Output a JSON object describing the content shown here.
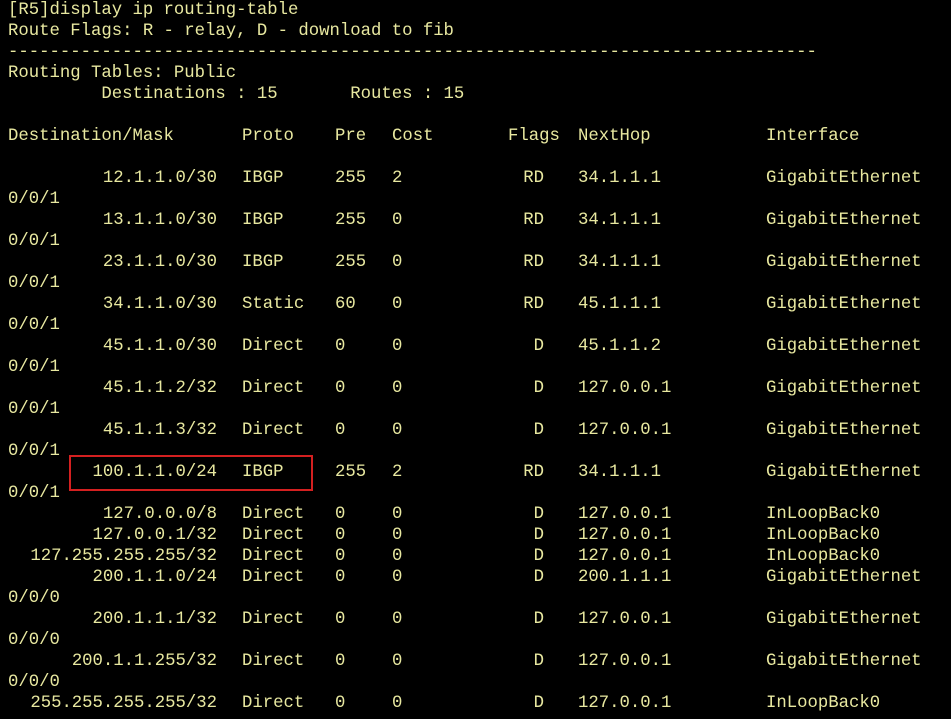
{
  "header": {
    "command": "[R5]display ip routing-table",
    "flags": "Route Flags: R - relay, D - download to fib",
    "separator": "------------------------------------------------------------------------------",
    "tables": "Routing Tables: Public",
    "counts": "         Destinations : 15       Routes : 15"
  },
  "columns": [
    "Destination/Mask",
    "Proto",
    "Pre",
    "Cost",
    "Flags",
    "NextHop",
    "Interface"
  ],
  "routes": [
    {
      "dest": "12.1.1.0/30",
      "proto": "IBGP",
      "pre": "255",
      "cost": "2",
      "flags": "RD",
      "nexthop": "34.1.1.1",
      "iface": "GigabitEthernet",
      "iface2": "0/0/1"
    },
    {
      "dest": "13.1.1.0/30",
      "proto": "IBGP",
      "pre": "255",
      "cost": "0",
      "flags": "RD",
      "nexthop": "34.1.1.1",
      "iface": "GigabitEthernet",
      "iface2": "0/0/1"
    },
    {
      "dest": "23.1.1.0/30",
      "proto": "IBGP",
      "pre": "255",
      "cost": "0",
      "flags": "RD",
      "nexthop": "34.1.1.1",
      "iface": "GigabitEthernet",
      "iface2": "0/0/1"
    },
    {
      "dest": "34.1.1.0/30",
      "proto": "Static",
      "pre": "60",
      "cost": "0",
      "flags": "RD",
      "nexthop": "45.1.1.1",
      "iface": "GigabitEthernet",
      "iface2": "0/0/1"
    },
    {
      "dest": "45.1.1.0/30",
      "proto": "Direct",
      "pre": "0",
      "cost": "0",
      "flags": "D",
      "nexthop": "45.1.1.2",
      "iface": "GigabitEthernet",
      "iface2": "0/0/1"
    },
    {
      "dest": "45.1.1.2/32",
      "proto": "Direct",
      "pre": "0",
      "cost": "0",
      "flags": "D",
      "nexthop": "127.0.0.1",
      "iface": "GigabitEthernet",
      "iface2": "0/0/1"
    },
    {
      "dest": "45.1.1.3/32",
      "proto": "Direct",
      "pre": "0",
      "cost": "0",
      "flags": "D",
      "nexthop": "127.0.0.1",
      "iface": "GigabitEthernet",
      "iface2": "0/0/1"
    },
    {
      "dest": "100.1.1.0/24",
      "proto": "IBGP",
      "pre": "255",
      "cost": "2",
      "flags": "RD",
      "nexthop": "34.1.1.1",
      "iface": "GigabitEthernet",
      "iface2": "0/0/1"
    },
    {
      "dest": "127.0.0.0/8",
      "proto": "Direct",
      "pre": "0",
      "cost": "0",
      "flags": "D",
      "nexthop": "127.0.0.1",
      "iface": "InLoopBack0",
      "iface2": ""
    },
    {
      "dest": "127.0.0.1/32",
      "proto": "Direct",
      "pre": "0",
      "cost": "0",
      "flags": "D",
      "nexthop": "127.0.0.1",
      "iface": "InLoopBack0",
      "iface2": ""
    },
    {
      "dest": "127.255.255.255/32",
      "proto": "Direct",
      "pre": "0",
      "cost": "0",
      "flags": "D",
      "nexthop": "127.0.0.1",
      "iface": "InLoopBack0",
      "iface2": ""
    },
    {
      "dest": "200.1.1.0/24",
      "proto": "Direct",
      "pre": "0",
      "cost": "0",
      "flags": "D",
      "nexthop": "200.1.1.1",
      "iface": "GigabitEthernet",
      "iface2": "0/0/0"
    },
    {
      "dest": "200.1.1.1/32",
      "proto": "Direct",
      "pre": "0",
      "cost": "0",
      "flags": "D",
      "nexthop": "127.0.0.1",
      "iface": "GigabitEthernet",
      "iface2": "0/0/0"
    },
    {
      "dest": "200.1.1.255/32",
      "proto": "Direct",
      "pre": "0",
      "cost": "0",
      "flags": "D",
      "nexthop": "127.0.0.1",
      "iface": "GigabitEthernet",
      "iface2": "0/0/0"
    },
    {
      "dest": "255.255.255.255/32",
      "proto": "Direct",
      "pre": "0",
      "cost": "0",
      "flags": "D",
      "nexthop": "127.0.0.1",
      "iface": "InLoopBack0",
      "iface2": ""
    }
  ]
}
